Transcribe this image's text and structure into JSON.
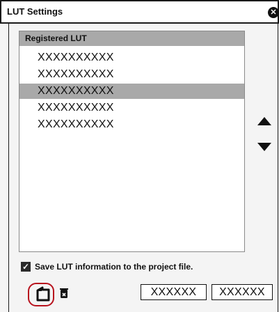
{
  "window": {
    "title": "LUT Settings",
    "close_glyph": "✕"
  },
  "lut_list": {
    "header": "Registered LUT",
    "items": [
      "XXXXXXXXXX",
      "XXXXXXXXXX",
      "XXXXXXXXXX",
      "XXXXXXXXXX",
      "XXXXXXXXXX"
    ],
    "selected_index": 2
  },
  "icons": {
    "move_up": "triangle-up-icon",
    "move_down": "triangle-down-icon",
    "import": "import-lut-icon",
    "delete": "delete-lut-icon"
  },
  "options": {
    "save_lut_label": "Save LUT information to the project file.",
    "save_lut_checked": true
  },
  "buttons": {
    "ok_label": "XXXXXX",
    "cancel_label": "XXXXXX"
  },
  "colors": {
    "selection": "#a9a9a9",
    "highlight_ring": "#b8121d"
  }
}
